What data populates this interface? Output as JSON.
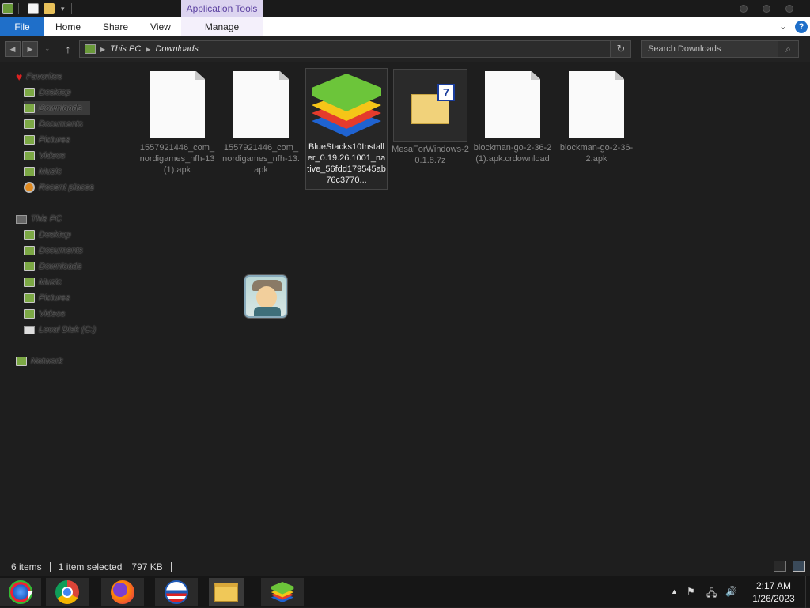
{
  "titlebar": {
    "contextual_tab": "Application Tools"
  },
  "ribbon": {
    "file": "File",
    "home": "Home",
    "share": "Share",
    "view": "View",
    "manage": "Manage",
    "help": "?"
  },
  "address": {
    "root": "This PC",
    "current": "Downloads",
    "search_placeholder": "Search Downloads"
  },
  "nav": {
    "favorites": "Favorites",
    "fav_items": [
      "Desktop",
      "Downloads",
      "Documents",
      "Pictures",
      "Videos",
      "Music",
      "Recent places"
    ],
    "this_pc": "This PC",
    "pc_items": [
      "Desktop",
      "Documents",
      "Downloads",
      "Music",
      "Pictures",
      "Videos",
      "Local Disk (C:)"
    ],
    "network": "Network"
  },
  "files": [
    {
      "name": "1557921446_com_nordigames_nfh-13 (1).apk",
      "icon": "blank-document-icon"
    },
    {
      "name": "1557921446_com_nordigames_nfh-13.apk",
      "icon": "blank-document-icon"
    },
    {
      "name": "BlueStacks10Installer_0.19.26.1001_native_56fdd179545ab76c3770...",
      "icon": "bluestacks-icon",
      "selected": true
    },
    {
      "name": "MesaForWindows-20.1.8.7z",
      "icon": "7zip-archive-icon"
    },
    {
      "name": "blockman-go-2-36-2 (1).apk.crdownload",
      "icon": "blank-document-icon"
    },
    {
      "name": "blockman-go-2-36-2.apk",
      "icon": "blank-document-icon"
    }
  ],
  "status": {
    "count": "6 items",
    "selection": "1 item selected",
    "size": "797 KB"
  },
  "clock": {
    "time": "2:17 AM",
    "date": "1/26/2023"
  },
  "taskbar_apps": [
    "start-orb-icon",
    "chrome-icon",
    "firefox-icon",
    "obama-logo-icon",
    "file-explorer-icon",
    "bluestacks-icon"
  ],
  "colors": {
    "file_tab": "#1f6fc9",
    "contextual_tab": "#dcd4f0",
    "background": "#1e1e1e"
  }
}
